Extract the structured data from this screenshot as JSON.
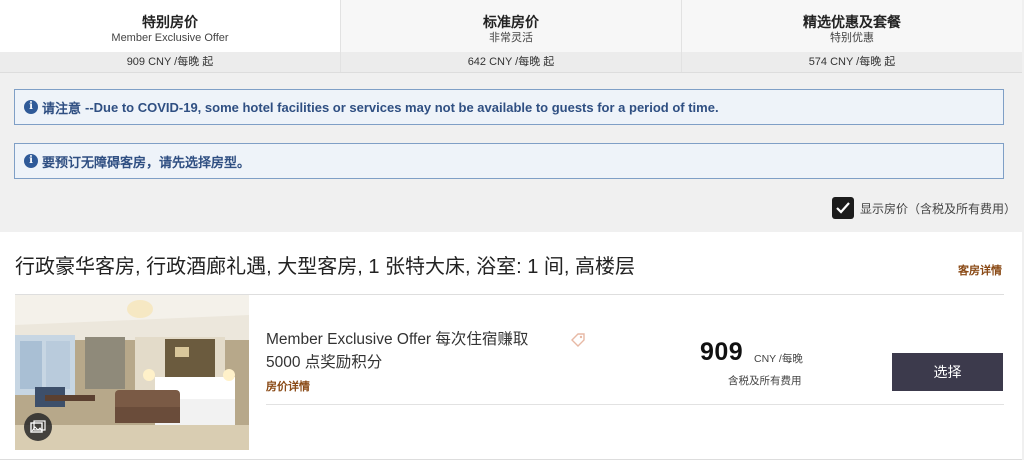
{
  "rate_tabs": [
    {
      "title": "特别房价",
      "subtitle": "Member Exclusive Offer",
      "price": "909 CNY /每晚 起"
    },
    {
      "title": "标准房价",
      "subtitle": "非常灵活",
      "price": "642 CNY /每晚 起"
    },
    {
      "title": "精选优惠及套餐",
      "subtitle": "特别优惠",
      "price": "574 CNY /每晚 起"
    }
  ],
  "notices": [
    {
      "strong": "请注意",
      "text": "--Due to COVID-19, some hotel facilities or services may not be available to guests for a period of time."
    },
    {
      "strong": "",
      "text": "要预订无障碍客房，请先选择房型。"
    }
  ],
  "show_price": {
    "label": "显示房价（含税及所有费用）",
    "checked": true
  },
  "room": {
    "title": "行政豪华客房, 行政酒廊礼遇, 大型客房, 1 张特大床, 浴室: 1 间, 高楼层",
    "details_link": "客房详情",
    "offer": {
      "name": "Member Exclusive Offer 每次住宿赚取 5000 点奖励积分",
      "rate_details_link": "房价详情",
      "price": "909",
      "price_unit": "CNY /每晚",
      "price_note": "含税及所有费用",
      "select_label": "选择"
    }
  },
  "colors": {
    "accent_link": "#8a4a16",
    "notice_text": "#2f4f82",
    "select_button": "#3c3a4c"
  },
  "icons": {
    "notice": "info-icon",
    "offer_tag": "tag-icon",
    "photo_badge": "gallery-icon",
    "checkbox": "check-icon"
  }
}
